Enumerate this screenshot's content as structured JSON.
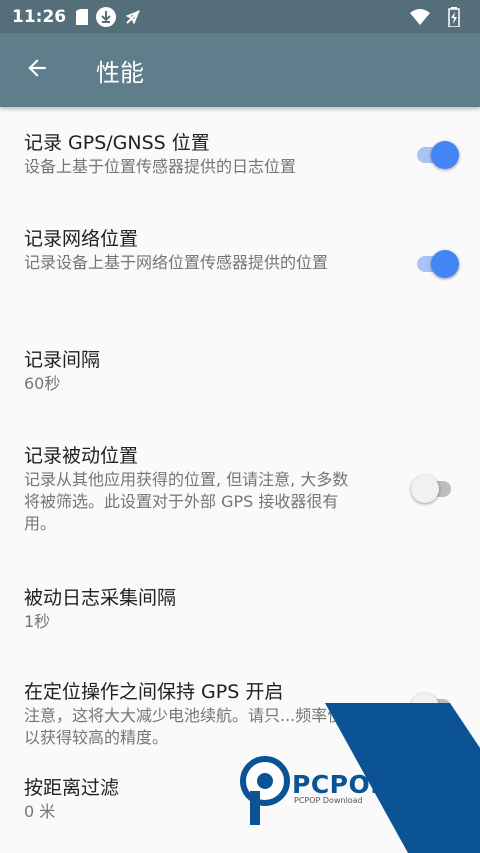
{
  "status_bar": {
    "time": "11:26",
    "icons": [
      "sim-card-icon",
      "download-icon",
      "location-off-icon",
      "wifi-icon",
      "battery-charging-icon"
    ]
  },
  "app_bar": {
    "back_icon": "arrow-back-icon",
    "title": "性能"
  },
  "settings": [
    {
      "title": "记录 GPS/GNSS 位置",
      "subtitle": "设备上基于位置传感器提供的日志位置",
      "switch": true,
      "checked": true
    },
    {
      "title": "记录网络位置",
      "subtitle": "记录设备上基于网络位置传感器提供的位置",
      "switch": true,
      "checked": true
    },
    {
      "title": "记录间隔",
      "subtitle": "60秒",
      "switch": false
    },
    {
      "title": "记录被动位置",
      "subtitle": "记录从其他应用获得的位置, 但请注意, 大多数将被筛选。此设置对于外部 GPS 接收器很有用。",
      "switch": true,
      "checked": false
    },
    {
      "title": "被动日志采集间隔",
      "subtitle": "1秒",
      "switch": false
    },
    {
      "title": "在定位操作之间保持 GPS 开启",
      "subtitle": "注意，这将大大减少电池续航。请只...频率使用以获得较高的精度。",
      "switch": true,
      "checked": false
    },
    {
      "title": "按距离过滤",
      "subtitle": "0 米",
      "switch": false
    }
  ],
  "watermark": {
    "brand": "PCPOP下载",
    "sub": "PCPOP Download"
  },
  "colors": {
    "status_bar": "#546e7a",
    "app_bar": "#607d8b",
    "switch_on": "#4285f4",
    "watermark_blue": "#0b5394"
  }
}
